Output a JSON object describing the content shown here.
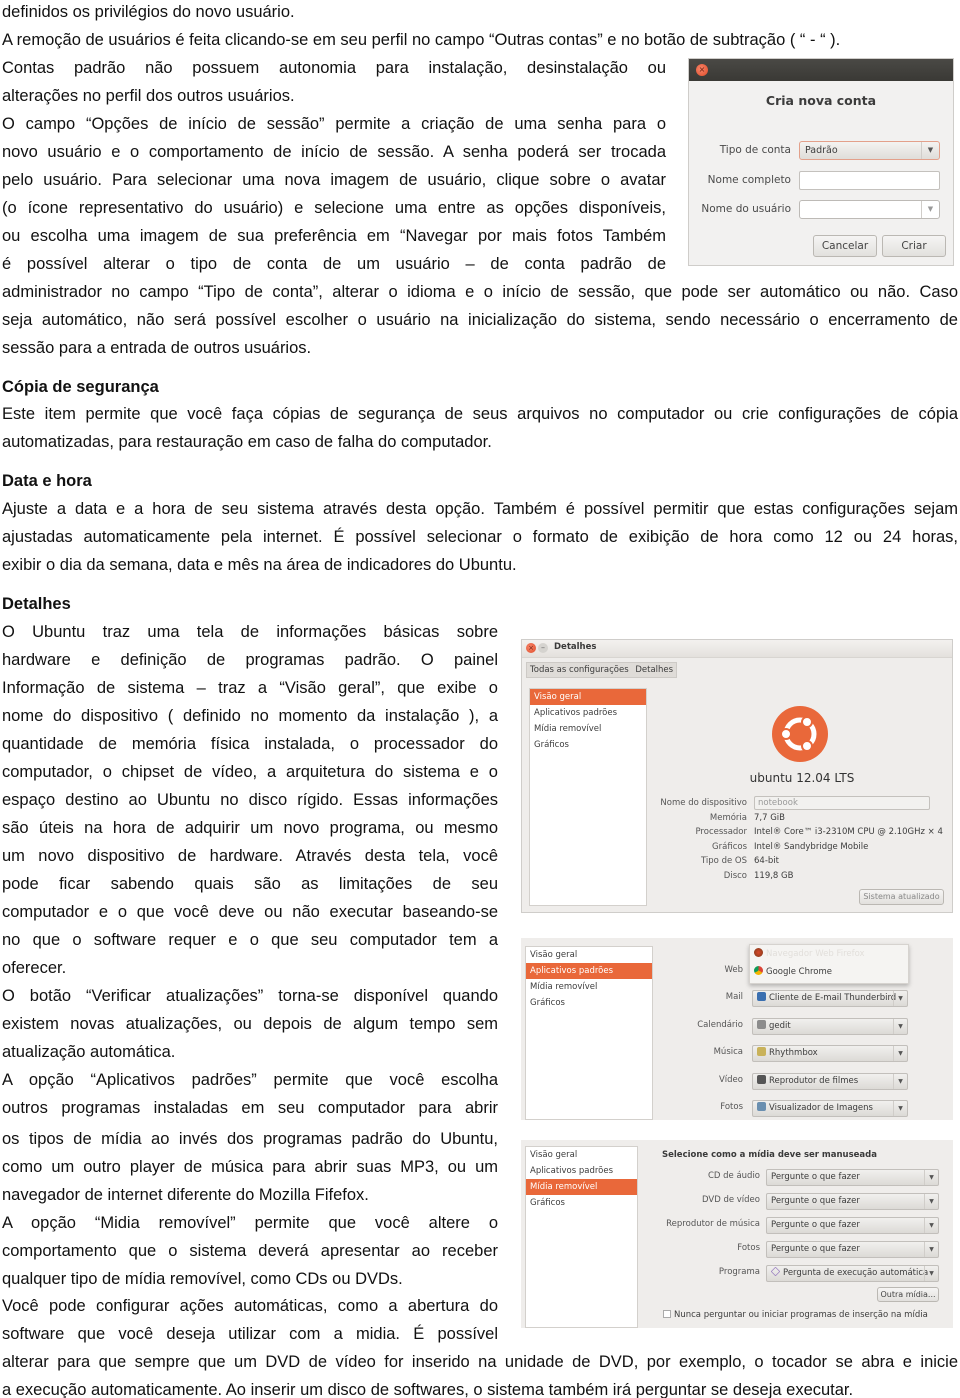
{
  "body_text": {
    "p1": "definidos os privilégios do novo usuário.",
    "p2": "A remoção de usuários é feita clicando-se em seu perfil no campo “Outras contas” e no botão de subtração ( “ - “ ).",
    "p3_lines": [
      "Contas padrão não possuem autonomia para instalação, desinstalação ou",
      "alterações no perfil dos outros usuários.",
      "O campo “Opções de início de sessão” permite a criação de uma senha para o",
      "novo usuário e o comportamento de início de sessão. A senha poderá ser trocada",
      "pelo usuário. Para selecionar uma nova imagem de usuário, clique sobre o avatar",
      "(o ícone representativo do usuário) e selecione uma entre as opções disponíveis,",
      "ou escolha uma imagem de sua preferência em “Navegar por mais fotos Também",
      "é possível alterar o tipo de conta de um usuário – de conta padrão de",
      "administrador no campo “Tipo de conta”, alterar o idioma e o início de sessão, que pode ser automático ou não. Caso",
      "seja automático, não será possível escolher o usuário na inicialização do sistema, sendo necessário o encerramento de",
      "sessão para a entrada de outros usuários."
    ],
    "copia_heading": "Cópia de segurança",
    "copia_lines": [
      "Este item permite que você faça cópias de segurança de seus arquivos no computador ou crie configurações de cópia",
      "automatizadas, para restauração em caso de falha do computador."
    ],
    "data_heading": "Data e hora",
    "data_lines": [
      "Ajuste a data e a hora de seu sistema através desta opção. Também é possível permitir que estas configurações sejam",
      "ajustadas automaticamente pela internet. É possível selecionar o formato de exibição de hora como 12 ou 24 horas,",
      "exibir o dia da semana, data e mês na área de indicadores do Ubuntu."
    ],
    "detalhes_heading": "Detalhes",
    "detalhes_lines": [
      "O Ubuntu traz uma tela de informações básicas sobre",
      "hardware e definição de programas padrão. O painel",
      "Informação de sistema – traz a “Visão geral”, que exibe o",
      "nome do dispositivo ( definido no momento da instalação ), a",
      "quantidade de memória física instalada, o processador do",
      "computador, o chipset de vídeo, a arquitetura do sistema e o",
      "espaço destino ao Ubuntu no disco rígido. Essas informações",
      "são úteis na hora de adquirir um novo programa, ou mesmo",
      "um novo dispositivo de hardware. Através desta tela, você",
      "pode ficar sabendo quais são as limitações de seu",
      "computador e o que você deve ou não executar baseando-se",
      "no que o software requer e o que seu computador tem a",
      "oferecer.",
      "O botão “Verificar atualizações” torna-se disponível quando",
      "existem novas atualizações, ou depois de algum tempo sem",
      "atualização automática.",
      "A opção “Aplicativos padrões” permite que você escolha",
      "outros programas instaladas em seu computador para abrir",
      "os tipos de mídia ao invés dos programas padrão do Ubuntu,",
      "como um outro player de música para abrir suas MP3, ou um",
      "navegador de internet diferente do Mozilla Fifefox.",
      "A opção “Midia removível” permite que você altere o",
      "comportamento que o sistema deverá apresentar ao receber",
      "qualquer tipo de mídia removível, como CDs ou DVDs.",
      "Você pode configurar ações automáticas, como a abertura do",
      "software que você deseja utilizar com a midia. É possível",
      "alterar para que sempre que um DVD de vídeo for inserido na unidade de DVD, por exemplo, o tocador se abra e inicie",
      "a execução automaticamente. Ao inserir um disco de softwares, o sistema também irá perguntar se deseja executar."
    ]
  },
  "dialog_new_account": {
    "title": "Cria nova conta",
    "tipo_label": "Tipo de conta",
    "tipo_value": "Padrão",
    "nome_completo_label": "Nome completo",
    "nome_completo_value": "",
    "nome_usuario_label": "Nome do usuário",
    "nome_usuario_value": "",
    "cancel": "Cancelar",
    "create": "Criar"
  },
  "details_window": {
    "title": "Detalhes",
    "breadcrumb": [
      "Todas as configurações",
      "Detalhes"
    ],
    "sidebar": [
      "Visão geral",
      "Aplicativos padrões",
      "Mídia removível",
      "Gráficos"
    ],
    "os_name": "ubuntu 12.04 LTS",
    "fields": [
      {
        "label": "Nome do dispositivo",
        "value": "notebook"
      },
      {
        "label": "Memória",
        "value": "7,7 GiB"
      },
      {
        "label": "Processador",
        "value": "Intel® Core™ i3-2310M CPU @ 2.10GHz × 4"
      },
      {
        "label": "Gráficos",
        "value": "Intel® Sandybridge Mobile"
      },
      {
        "label": "Tipo de OS",
        "value": "64-bit"
      },
      {
        "label": "Disco",
        "value": "119,8 GB"
      }
    ],
    "update_button": "Sistema atualizado",
    "brand_color": "#e9683a"
  },
  "default_apps": {
    "sidebar": [
      "Visão geral",
      "Aplicativos padrões",
      "Mídia removível",
      "Gráficos"
    ],
    "web_label": "Web",
    "web_options": [
      "Navegador Web Firefox",
      "Google Chrome"
    ],
    "rows": [
      {
        "label": "Mail",
        "value": "Cliente de E-mail Thunderbird",
        "icon": "thunderbird-icon"
      },
      {
        "label": "Calendário",
        "value": "gedit",
        "icon": "gedit-icon"
      },
      {
        "label": "Música",
        "value": "Rhythmbox",
        "icon": "rhythmbox-icon"
      },
      {
        "label": "Vídeo",
        "value": "Reprodutor de filmes",
        "icon": "video-player-icon"
      },
      {
        "label": "Fotos",
        "value": "Visualizador de Imagens",
        "icon": "image-viewer-icon"
      }
    ]
  },
  "removable_media": {
    "sidebar": [
      "Visão geral",
      "Aplicativos padrões",
      "Mídia removível",
      "Gráficos"
    ],
    "heading": "Selecione como a mídia deve ser manuseada",
    "rows": [
      {
        "label": "CD de áudio",
        "value": "Pergunte o que fazer"
      },
      {
        "label": "DVD de vídeo",
        "value": "Pergunte o que fazer"
      },
      {
        "label": "Reprodutor de música",
        "value": "Pergunte o que fazer"
      },
      {
        "label": "Fotos",
        "value": "Pergunte o que fazer"
      },
      {
        "label": "Programa",
        "value": "Pergunta de execução automática"
      }
    ],
    "other_media_button": "Outra mídia...",
    "never_ask_checkbox": "Nunca perguntar ou iniciar programas de inserção na mídia",
    "never_ask_checked": false
  }
}
